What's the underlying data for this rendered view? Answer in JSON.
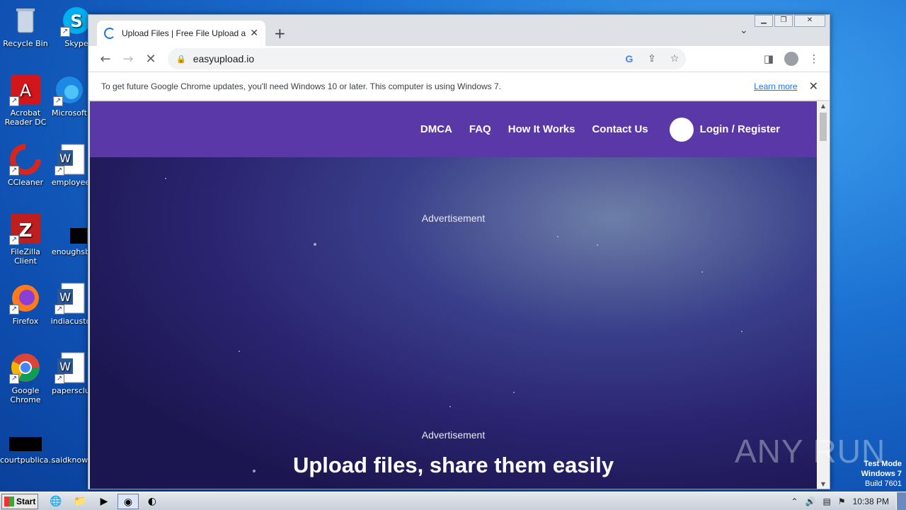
{
  "desktop": {
    "icons": [
      {
        "label": "Recycle Bin"
      },
      {
        "label": "Skype"
      },
      {
        "label": "Acrobat Reader DC"
      },
      {
        "label": "Microsoft"
      },
      {
        "label": "CCleaner"
      },
      {
        "label": "employee"
      },
      {
        "label": "FileZilla Client"
      },
      {
        "label": "enoughsb"
      },
      {
        "label": "Firefox"
      },
      {
        "label": "indiacusto"
      },
      {
        "label": "Google Chrome"
      },
      {
        "label": "papersclu"
      },
      {
        "label": "courtpublica..."
      },
      {
        "label": "saidknowl"
      }
    ]
  },
  "browser": {
    "tab_title": "Upload Files | Free File Upload and T",
    "url": "easyupload.io",
    "infobar": {
      "text": "To get future Google Chrome updates, you'll need Windows 10 or later. This computer is using Windows 7.",
      "link": "Learn more"
    }
  },
  "site": {
    "nav": [
      "DMCA",
      "FAQ",
      "How It Works",
      "Contact Us"
    ],
    "login": "Login / Register",
    "ad_label_1": "Advertisement",
    "ad_label_2": "Advertisement",
    "hero_title": "Upload files, share them easily"
  },
  "watermark": "ANY RUN",
  "testmode": {
    "line1": "Test Mode",
    "line2": "Windows 7",
    "line3": "Build 7601"
  },
  "taskbar": {
    "start": "Start",
    "clock": "10:38 PM"
  }
}
